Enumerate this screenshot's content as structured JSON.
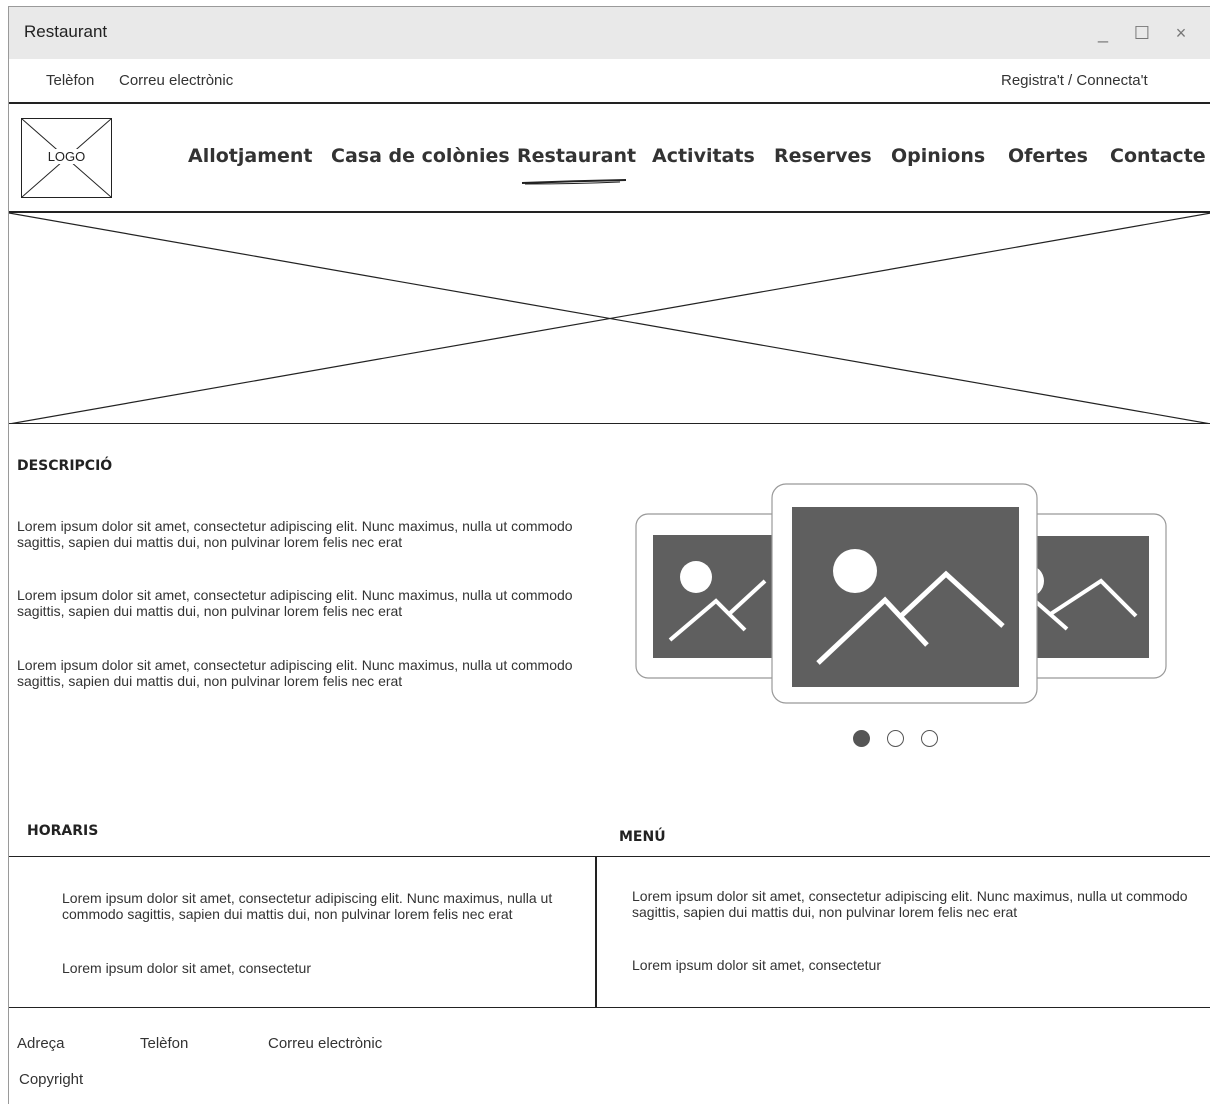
{
  "window": {
    "title": "Restaurant",
    "controls": {
      "minimize": "_",
      "maximize": "☐",
      "close": "×"
    }
  },
  "topbar": {
    "phone": "Telèfon",
    "email": "Correu electrònic",
    "auth": "Registra't / Connecta't"
  },
  "logo": {
    "label": "LOGO"
  },
  "nav": {
    "items": [
      {
        "label": "Allotjament"
      },
      {
        "label": "Casa de colònies"
      },
      {
        "label": "Restaurant"
      },
      {
        "label": "Activitats"
      },
      {
        "label": "Reserves"
      },
      {
        "label": "Opinions"
      },
      {
        "label": "Ofertes"
      },
      {
        "label": "Contacte"
      }
    ],
    "active": "Restaurant"
  },
  "description": {
    "title": "DESCRIPCIÓ",
    "paragraphs": [
      "Lorem ipsum dolor sit amet, consectetur adipiscing elit. Nunc maximus, nulla ut commodo sagittis, sapien dui mattis dui, non pulvinar lorem felis nec erat",
      "Lorem ipsum dolor sit amet, consectetur adipiscing elit. Nunc maximus, nulla ut commodo sagittis, sapien dui mattis dui, non pulvinar lorem felis nec erat",
      "Lorem ipsum dolor sit amet, consectetur adipiscing elit. Nunc maximus, nulla ut commodo sagittis, sapien dui mattis dui, non pulvinar lorem felis nec erat"
    ]
  },
  "carousel": {
    "slide_count": 3,
    "active_slide": 1,
    "icon": "image-placeholder-icon"
  },
  "hours": {
    "title": "HORARIS",
    "paragraphs": [
      "Lorem ipsum dolor sit amet, consectetur adipiscing elit. Nunc maximus, nulla ut commodo sagittis, sapien dui mattis dui, non pulvinar lorem felis nec erat",
      "Lorem ipsum dolor sit amet, consectetur"
    ]
  },
  "menu": {
    "title": "MENÚ",
    "paragraphs": [
      "Lorem ipsum dolor sit amet, consectetur adipiscing elit. Nunc maximus, nulla ut commodo sagittis, sapien dui mattis dui, non pulvinar lorem felis nec erat",
      "Lorem ipsum dolor sit amet, consectetur"
    ]
  },
  "footer": {
    "address": "Adreça",
    "phone": "Telèfon",
    "email": "Correu electrònic",
    "copyright": "Copyright"
  },
  "colors": {
    "titlebar": "#e9e9e9",
    "line": "#222222",
    "placeholder_fill": "#5f5f5f"
  }
}
